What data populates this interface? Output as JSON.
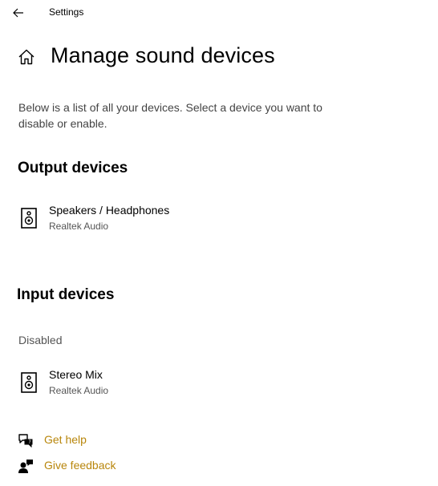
{
  "window": {
    "title": "Settings",
    "back_icon": "back-arrow-icon"
  },
  "header": {
    "title": "Manage sound devices",
    "home_icon": "home-icon"
  },
  "description": "Below is a list of all your devices. Select a device you want to disable or enable.",
  "output": {
    "heading": "Output devices",
    "devices": [
      {
        "name": "Speakers / Headphones",
        "subtitle": "Realtek Audio",
        "icon": "speaker-icon"
      }
    ]
  },
  "input": {
    "heading": "Input devices",
    "disabled_label": "Disabled",
    "devices": [
      {
        "name": "Stereo Mix",
        "subtitle": "Realtek Audio",
        "icon": "speaker-icon"
      }
    ]
  },
  "links": {
    "help": {
      "label": "Get help",
      "icon": "help-chat-icon"
    },
    "feedback": {
      "label": "Give feedback",
      "icon": "feedback-person-icon"
    }
  },
  "colors": {
    "link": "#b8860b",
    "secondary_text": "#555555"
  }
}
